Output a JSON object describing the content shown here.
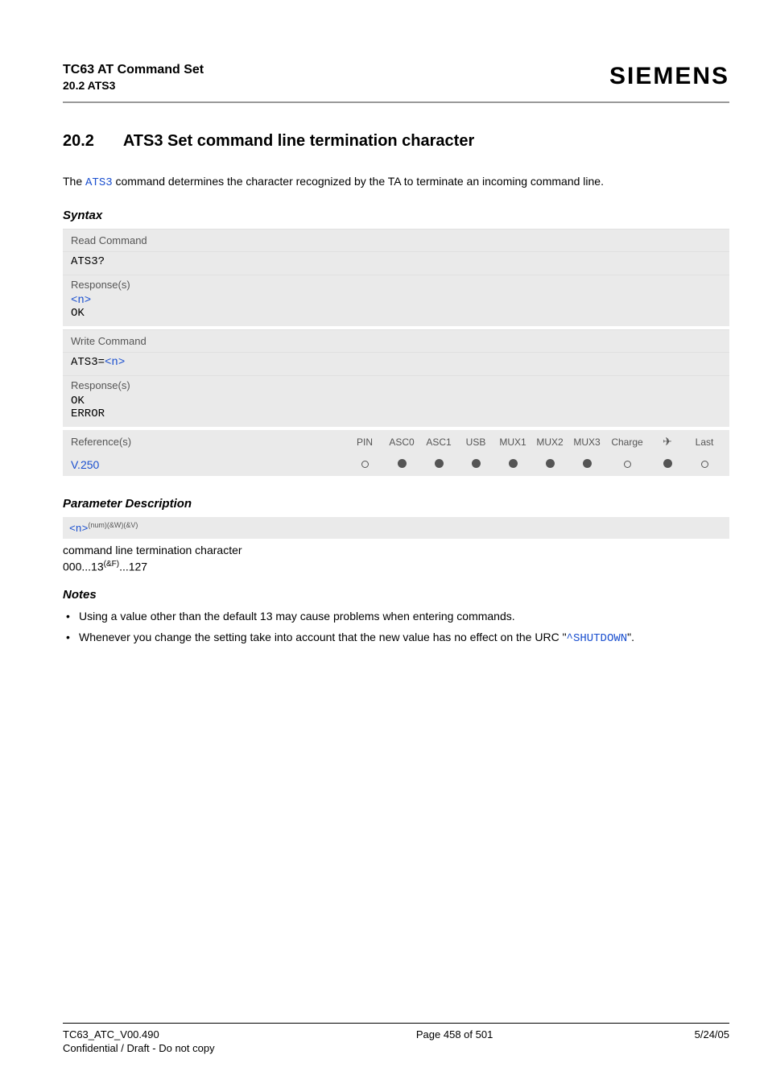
{
  "header": {
    "title": "TC63 AT Command Set",
    "sub": "20.2 ATS3",
    "brand": "SIEMENS"
  },
  "section": {
    "num": "20.2",
    "title": "ATS3   Set command line termination character"
  },
  "intro": {
    "pre": "The ",
    "cmd": "ATS3",
    "post": " command determines the character recognized by the TA to terminate an incoming command line."
  },
  "syntax": {
    "heading": "Syntax",
    "read_label": "Read Command",
    "read_cmd": "ATS3?",
    "response_label": "Response(s)",
    "read_resp_n": "<n>",
    "read_resp_ok": "OK",
    "write_label": "Write Command",
    "write_cmd_pre": "ATS3=",
    "write_cmd_n": "<n>",
    "write_resp_ok": "OK",
    "write_resp_err": "ERROR",
    "ref_label": "Reference(s)",
    "ref_value": "V.250",
    "caps": [
      "PIN",
      "ASC0",
      "ASC1",
      "USB",
      "MUX1",
      "MUX2",
      "MUX3",
      "Charge",
      "✈",
      "Last"
    ],
    "cap_states": [
      "empty",
      "filled",
      "filled",
      "filled",
      "filled",
      "filled",
      "filled",
      "empty",
      "filled",
      "empty"
    ]
  },
  "param": {
    "heading": "Parameter Description",
    "n": "<n>",
    "sup": "(num)(&W)(&V)",
    "desc": "command line termination character",
    "range_pre": "000...13",
    "range_sup": "(&F)",
    "range_post": "...127"
  },
  "notes": {
    "heading": "Notes",
    "items": [
      {
        "text": "Using a value other than the default 13 may cause problems when entering commands."
      },
      {
        "pre": "Whenever you change the setting take into account that the new value has no effect on the URC \"",
        "link": "^SHUTDOWN",
        "post": "\"."
      }
    ]
  },
  "footer": {
    "left1": "TC63_ATC_V00.490",
    "left2": "Confidential / Draft - Do not copy",
    "mid": "Page 458 of 501",
    "right": "5/24/05"
  }
}
